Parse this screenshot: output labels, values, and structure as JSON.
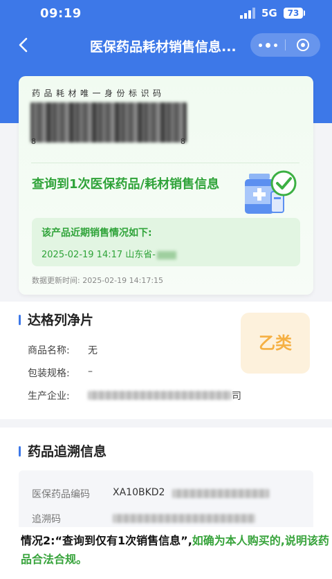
{
  "status_bar": {
    "time": "09:19",
    "network": "5G",
    "battery": "73"
  },
  "nav": {
    "title": "医保药品耗材销售信息..."
  },
  "id_card": {
    "label": "药品耗材唯一身份标识码",
    "code_start": "8",
    "code_end": "8",
    "result_text": "查询到1次医保药品/耗材销售信息",
    "recent_title": "该产品近期销售情况如下:",
    "recent_row": "2025-02-19 14:17 山东省-",
    "update_time": "数据更新时间: 2025-02-19 14:17:15"
  },
  "product": {
    "title": "达格列净片",
    "badge": "乙类",
    "name_label": "商品名称:",
    "name_value": "无",
    "spec_label": "包装规格:",
    "spec_value": "–",
    "maker_label": "生产企业:",
    "maker_suffix": "司"
  },
  "trace": {
    "title": "药品追溯信息",
    "code_label": "医保药品编码",
    "code_value": "XA10BKD2",
    "trace_label": "追溯码"
  },
  "caption": {
    "part1": "情况2:“查询到仅有1次销售信息”,",
    "part2": "如确为本人购买的,说明该药品合法合规。"
  },
  "colors": {
    "brand_blue": "#3d78e8",
    "success_green": "#2fa339",
    "badge_orange": "#f5b043"
  }
}
